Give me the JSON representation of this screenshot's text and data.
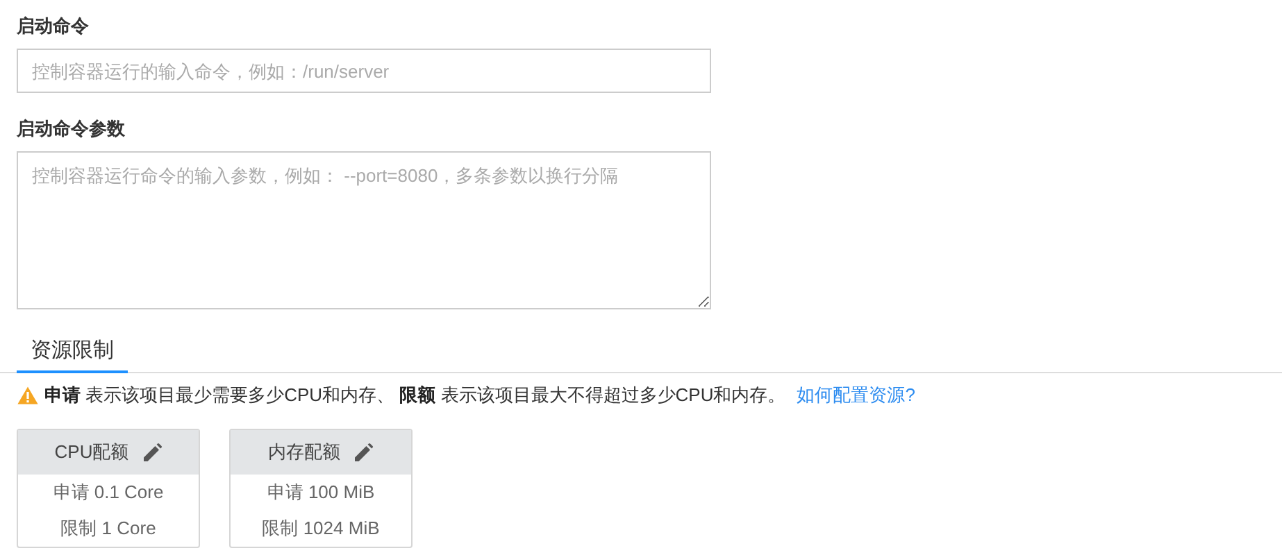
{
  "fields": [
    {
      "kind": "input",
      "label": "启动命令",
      "placeholder": "控制容器运行的输入命令，例如：/run/server"
    },
    {
      "kind": "textarea",
      "label": "启动命令参数",
      "placeholder": "控制容器运行命令的输入参数，例如： --port=8080，多条参数以换行分隔"
    }
  ],
  "tabs": [
    {
      "label": "资源限制",
      "selected": true
    }
  ],
  "notice": {
    "text": "**申请** 表示该项目最少需要多少CPU和内存、 **限额** 表示该项目最大不得超过多少CPU和内存。",
    "link": "如何配置资源?"
  },
  "quotas": [
    {
      "title": "CPU配额",
      "request": "申请 0.1 Core",
      "limit": "限制 1 Core"
    },
    {
      "title": "内存配额",
      "request": "申请 100 MiB",
      "limit": "限制 1024 MiB"
    }
  ]
}
